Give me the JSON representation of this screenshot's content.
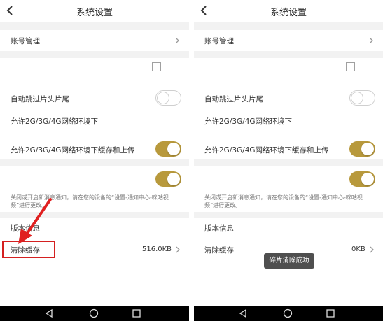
{
  "screens": [
    {
      "title": "系统设置",
      "account": "账号管理",
      "skip_intro": "自动跳过片头片尾",
      "allow_network": "允许2G/3G/4G网络环境下",
      "allow_cache_upload": "允许2G/3G/4G网络环境下缓存和上传",
      "notify_desc": "关闭或开启新消息通知，请在您的设备的“设置-通知中心-咪咕视频”进行更改。",
      "version": "版本信息",
      "clear_cache": "清除缓存",
      "cache_size": "516.0KB",
      "toggles": {
        "skip_intro": false,
        "cache_upload": true,
        "notify": true
      }
    },
    {
      "title": "系统设置",
      "account": "账号管理",
      "skip_intro": "自动跳过片头片尾",
      "allow_network": "允许2G/3G/4G网络环境下",
      "allow_cache_upload": "允许2G/3G/4G网络环境下缓存和上传",
      "notify_desc": "关闭或开启新消息通知，请在您的设备的“设置-通知中心-咪咕视频”进行更改。",
      "version": "版本信息",
      "clear_cache": "清除缓存",
      "cache_size": "0KB",
      "toast": "碎片清除成功",
      "toggles": {
        "skip_intro": false,
        "cache_upload": true,
        "notify": true
      }
    }
  ],
  "colors": {
    "toggle_on": "#b8993c",
    "highlight": "#d42020",
    "navbar": "#000000"
  },
  "icons": [
    "back-icon",
    "chevron-right-icon",
    "nav-back-icon",
    "nav-home-icon",
    "nav-recent-icon",
    "arrow-annotation"
  ]
}
